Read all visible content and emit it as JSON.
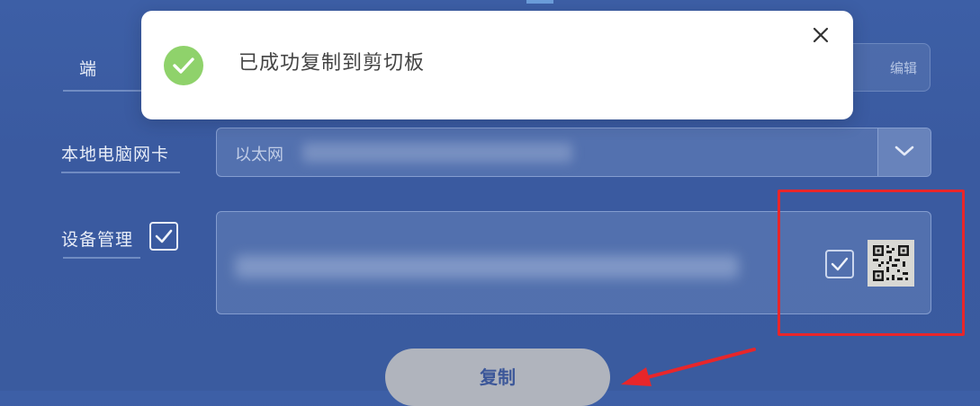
{
  "form": {
    "row1": {
      "label": "端",
      "action_label": "编辑"
    },
    "network_card": {
      "label": "本地电脑网卡",
      "selected_value": "以太网",
      "dropdown_icon": "chevron-down-icon"
    },
    "device_management": {
      "label": "设备管理",
      "checked": true,
      "item_checked": true,
      "qr_icon": "qr-code-icon"
    },
    "copy_button_label": "复制"
  },
  "toast": {
    "message": "已成功复制到剪切板",
    "icon": "success-check-icon",
    "close_icon": "close-icon"
  },
  "colors": {
    "background": "#3a5aa0",
    "annotation_red": "#e8262a",
    "success_green": "#8fd26b",
    "copy_button_bg": "#b0b4bd",
    "copy_button_text": "#3c5799"
  }
}
